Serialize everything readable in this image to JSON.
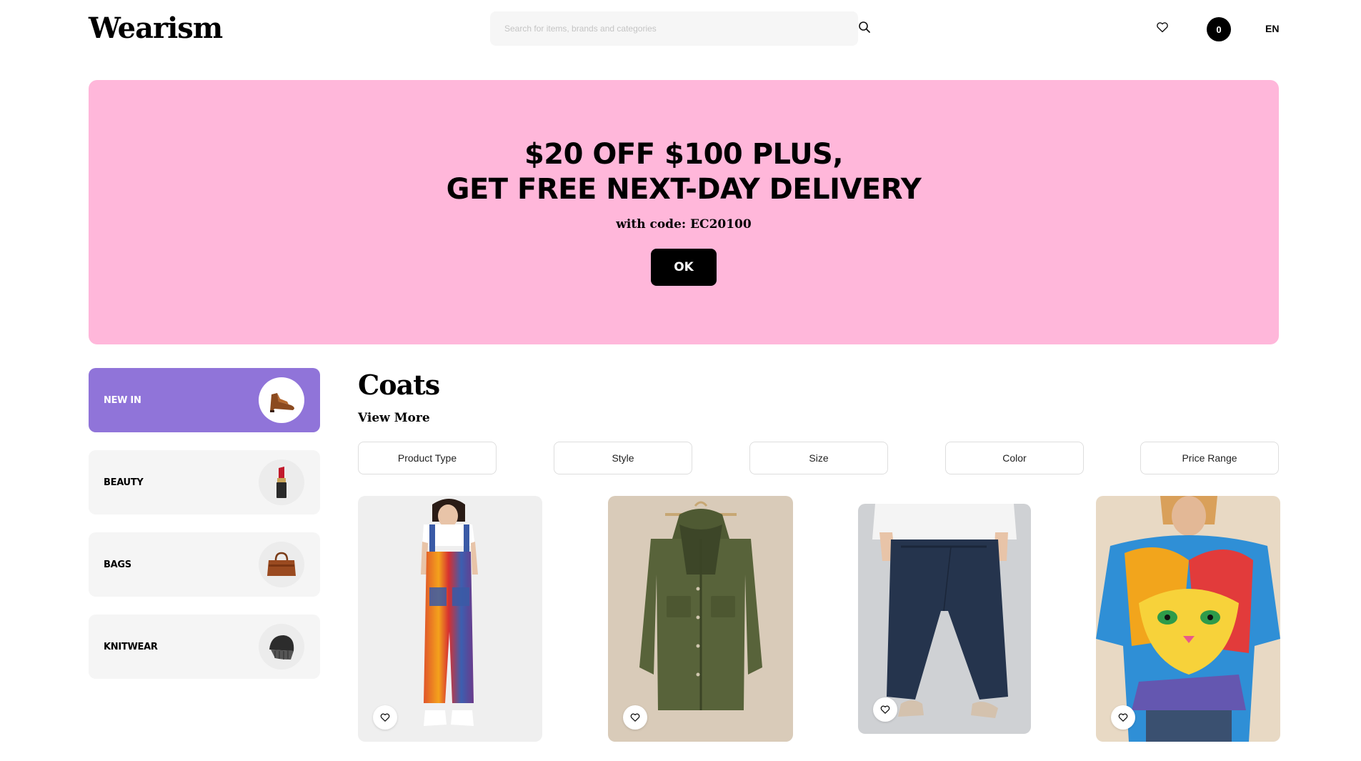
{
  "header": {
    "logo": "Wearism",
    "search_placeholder": "Search for items, brands and categories",
    "cart_count": "0",
    "language": "EN"
  },
  "banner": {
    "line1": "$20 OFF $100 PLUS,",
    "line2": "GET FREE NEXT-DAY DELIVERY",
    "subtitle": "with code: EC20100",
    "button_label": "OK",
    "background_color": "#ffb7da"
  },
  "categories": [
    {
      "label": "NEW IN",
      "icon": "shoe-icon",
      "active": true
    },
    {
      "label": "BEAUTY",
      "icon": "lipstick-icon",
      "active": false
    },
    {
      "label": "BAGS",
      "icon": "handbag-icon",
      "active": false
    },
    {
      "label": "KNITWEAR",
      "icon": "beanie-icon",
      "active": false
    }
  ],
  "section": {
    "title": "Coats",
    "view_more": "View More"
  },
  "filters": [
    "Product Type",
    "Style",
    "Size",
    "Color",
    "Price Range"
  ],
  "products": [
    {
      "name": "striped-overalls"
    },
    {
      "name": "olive-hooded-jacket"
    },
    {
      "name": "navy-cropped-trousers"
    },
    {
      "name": "cat-print-tee"
    }
  ],
  "colors": {
    "accent_purple": "#9074d9",
    "banner_pink": "#ffb7da",
    "card_gray": "#f5f5f5"
  }
}
